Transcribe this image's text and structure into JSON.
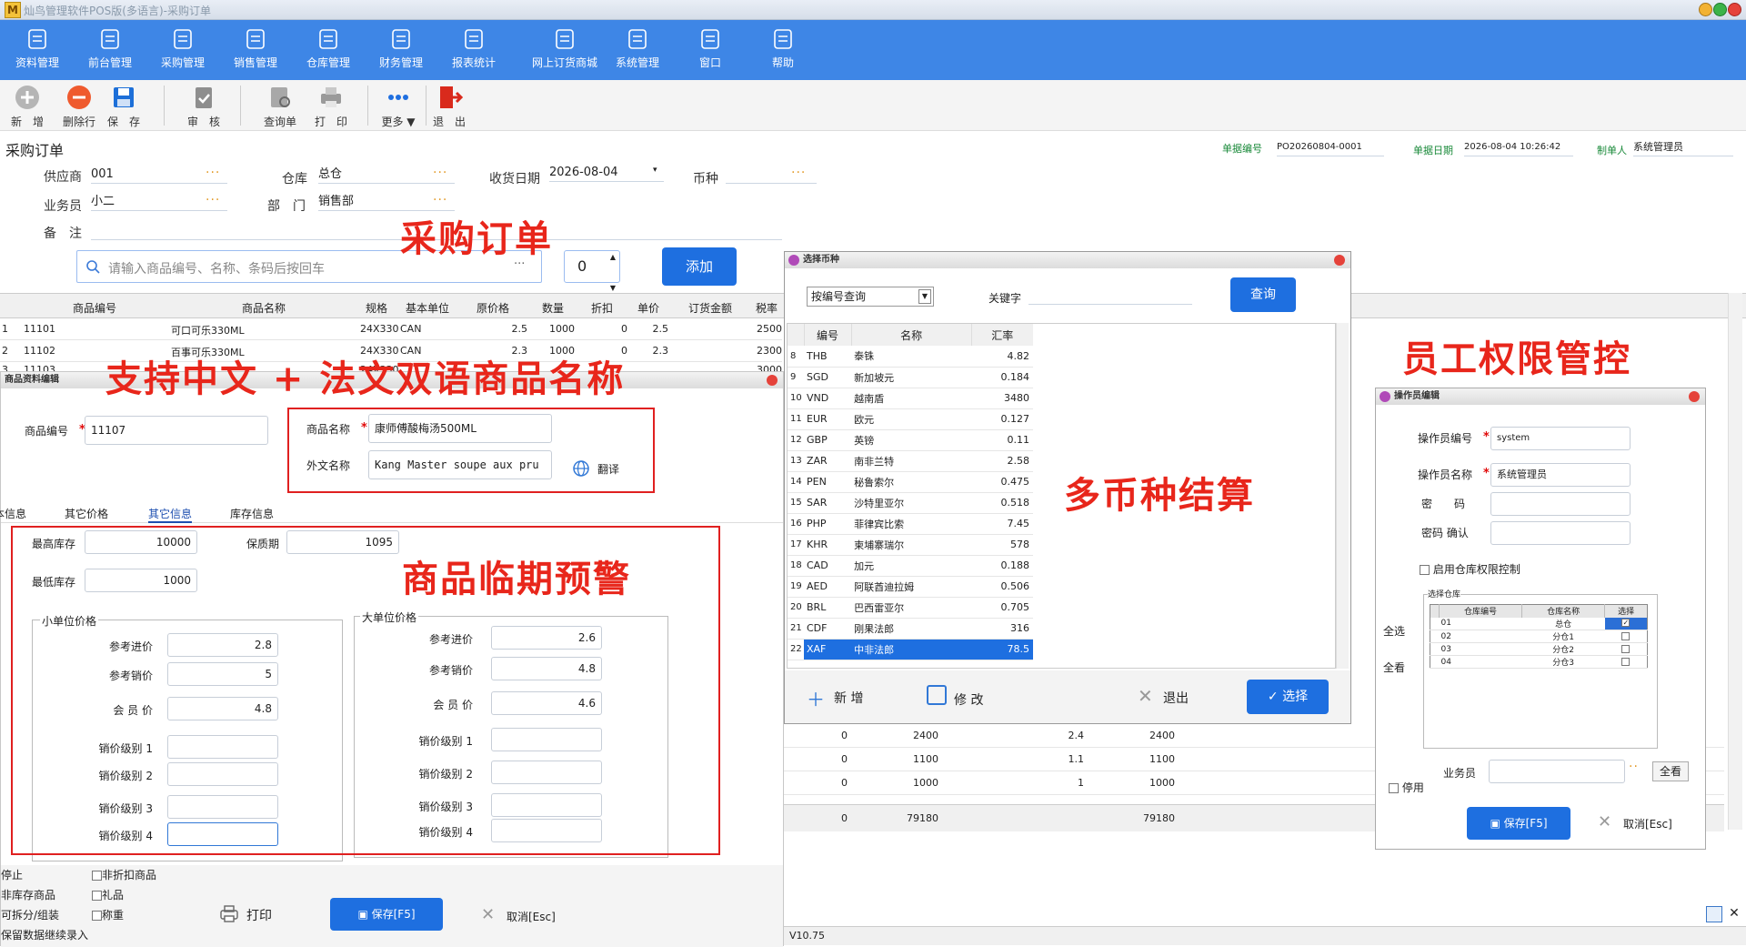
{
  "window": {
    "title": "灿鸟管理软件POS版(多语言)-采购订单",
    "version": "V10.75"
  },
  "ribbon": [
    "资料管理",
    "前台管理",
    "采购管理",
    "销售管理",
    "仓库管理",
    "财务管理",
    "报表统计",
    "网上订货商城",
    "系统管理",
    "窗口",
    "帮助"
  ],
  "toolbar": {
    "new": "新　增",
    "delete_row": "删除行",
    "save": "保　存",
    "audit": "审　核",
    "query": "查询单",
    "print": "打　印",
    "more": "更多",
    "exit": "退　出"
  },
  "order": {
    "title": "采购订单",
    "supplier_label": "供应商",
    "supplier": "001",
    "warehouse_label": "仓库",
    "warehouse": "总仓",
    "receive_date_label": "收货日期",
    "receive_date": "2026-08-04",
    "currency_label": "币种",
    "salesman_label": "业务员",
    "salesman": "小二",
    "dept_label": "部　门",
    "dept": "销售部",
    "note_label": "备　注",
    "doc_no_label": "单据编号",
    "doc_no": "PO20260804-0001",
    "doc_date_label": "单据日期",
    "doc_date": "2026-08-04 10:26:42",
    "maker_label": "制单人",
    "maker": "系统管理员",
    "search_placeholder": "请输入商品编号、名称、条码后按回车",
    "qty": "0",
    "add_btn": "添加"
  },
  "grid": {
    "headers": [
      "商品编号",
      "商品名称",
      "规格",
      "基本单位",
      "原价格",
      "数量",
      "折扣",
      "单价",
      "订货金额",
      "税率"
    ],
    "rows": [
      [
        "1",
        "11101",
        "可口可乐330ML",
        "24X330",
        "CAN",
        "2.5",
        "1000",
        "0",
        "2.5",
        "2500"
      ],
      [
        "2",
        "11102",
        "百事可乐330ML",
        "24X330",
        "CAN",
        "2.3",
        "1000",
        "0",
        "2.3",
        "2300"
      ]
    ],
    "partial_row": [
      "3",
      "11103",
      "",
      "24X330",
      "",
      "",
      "",
      "",
      "",
      "3000"
    ]
  },
  "annotations": {
    "purchase_order": "采购订单",
    "bilingual": "支持中文 + 法文双语商品名称",
    "expiry_warning": "商品临期预警",
    "multi_currency": "多币种结算",
    "staff_permission": "员工权限管控"
  },
  "product_dialog": {
    "title": "商品资料编辑",
    "code_label": "商品编号",
    "code": "11107",
    "name_label": "商品名称",
    "name": "康师傅酸梅汤500ML",
    "foreign_label": "外文名称",
    "foreign": "Kang Master soupe aux pru",
    "translate": "翻译",
    "tabs": [
      "基本信息",
      "其它价格",
      "其它信息",
      "库存信息"
    ],
    "max_stock_label": "最高库存",
    "max_stock": "10000",
    "shelf_label": "保质期",
    "shelf": "1095",
    "min_stock_label": "最低库存",
    "min_stock": "1000",
    "small_unit": "小单位价格",
    "big_unit": "大单位价格",
    "small": [
      {
        "label": "参考进价",
        "value": "2.8"
      },
      {
        "label": "参考销价",
        "value": "5"
      },
      {
        "label": "会 员 价",
        "value": "4.8"
      },
      {
        "label": "销价级别 1",
        "value": ""
      },
      {
        "label": "销价级别 2",
        "value": ""
      },
      {
        "label": "销价级别 3",
        "value": ""
      },
      {
        "label": "销价级别 4",
        "value": ""
      }
    ],
    "big": [
      {
        "label": "参考进价",
        "value": "2.6"
      },
      {
        "label": "参考销价",
        "value": "4.8"
      },
      {
        "label": "会 员 价",
        "value": "4.6"
      },
      {
        "label": "销价级别 1",
        "value": ""
      },
      {
        "label": "销价级别 2",
        "value": ""
      },
      {
        "label": "销价级别 3",
        "value": ""
      },
      {
        "label": "销价级别 4",
        "value": ""
      }
    ],
    "left_labels": [
      "停止",
      "非库存商品",
      "可拆分/组装",
      "保留数据继续录入"
    ],
    "checkboxes": [
      "非折扣商品",
      "礼品",
      "称重"
    ],
    "print": "打印",
    "save": "保存[F5]",
    "cancel": "取消[Esc]"
  },
  "currency_dialog": {
    "title": "选择币种",
    "mode": "按编号查询",
    "keyword_label": "关键字",
    "query": "查询",
    "headers": [
      "编号",
      "名称",
      "汇率"
    ],
    "rows": [
      [
        "8",
        "THB",
        "泰铢",
        "4.82"
      ],
      [
        "9",
        "SGD",
        "新加坡元",
        "0.184"
      ],
      [
        "10",
        "VND",
        "越南盾",
        "3480"
      ],
      [
        "11",
        "EUR",
        "欧元",
        "0.127"
      ],
      [
        "12",
        "GBP",
        "英镑",
        "0.11"
      ],
      [
        "13",
        "ZAR",
        "南非兰特",
        "2.58"
      ],
      [
        "14",
        "PEN",
        "秘鲁索尔",
        "0.475"
      ],
      [
        "15",
        "SAR",
        "沙特里亚尔",
        "0.518"
      ],
      [
        "16",
        "PHP",
        "菲律宾比索",
        "7.45"
      ],
      [
        "17",
        "KHR",
        "柬埔寨瑞尔",
        "578"
      ],
      [
        "18",
        "CAD",
        "加元",
        "0.188"
      ],
      [
        "19",
        "AED",
        "阿联酋迪拉姆",
        "0.506"
      ],
      [
        "20",
        "BRL",
        "巴西雷亚尔",
        "0.705"
      ],
      [
        "21",
        "CDF",
        "刚果法郎",
        "316"
      ],
      [
        "22",
        "XAF",
        "中非法郎",
        "78.5"
      ]
    ],
    "new": "新 增",
    "edit": "修 改",
    "exit": "退出",
    "select": "选择"
  },
  "bottom_rows": [
    [
      "0",
      "2400",
      "2.4",
      "2400"
    ],
    [
      "0",
      "1100",
      "1.1",
      "1100"
    ],
    [
      "0",
      "1000",
      "1",
      "1000"
    ]
  ],
  "totals": [
    "0",
    "79180",
    "79180"
  ],
  "operator_dialog": {
    "title": "操作员编辑",
    "id_label": "操作员编号",
    "id": "system",
    "name_label": "操作员名称",
    "name": "系统管理员",
    "pwd_label": "密　　码",
    "confirm_label": "密码 确认",
    "enable_wh": "启用仓库权限控制",
    "select_wh": "选择仓库",
    "wh_headers": [
      "仓库编号",
      "仓库名称",
      "选择"
    ],
    "wh_rows": [
      [
        "01",
        "总仓",
        true
      ],
      [
        "02",
        "分仓1",
        false
      ],
      [
        "03",
        "分仓2",
        false
      ],
      [
        "04",
        "分仓3",
        false
      ]
    ],
    "select_all": "全选",
    "all": "全看",
    "salesman_label": "业务员",
    "all2": "全看",
    "disable": "停用",
    "save": "保存[F5]",
    "cancel": "取消[Esc]"
  }
}
